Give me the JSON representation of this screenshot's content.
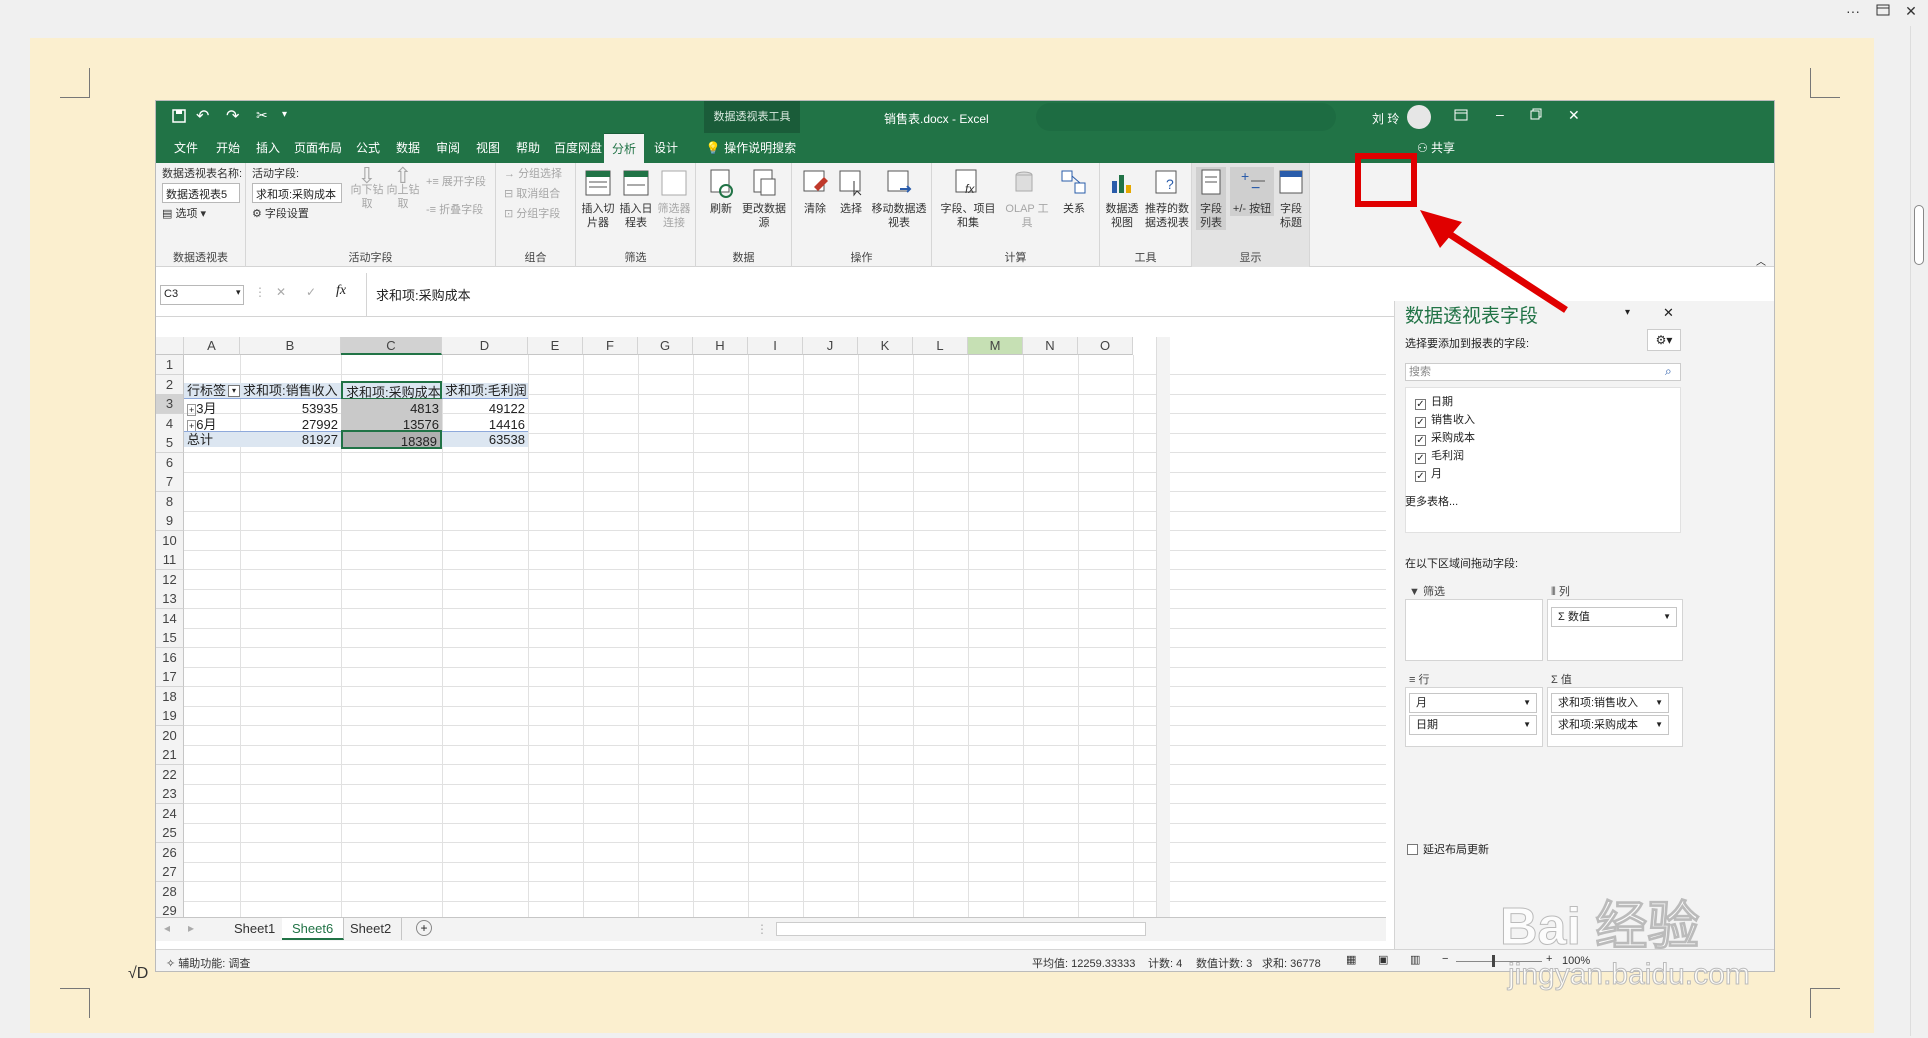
{
  "word": {
    "dots": "···"
  },
  "excel": {
    "file_title": "销售表.docx - Excel",
    "context_tools": "数据透视表工具",
    "user": "刘 玲",
    "share": "共享",
    "tell_me": "操作说明搜索",
    "tabs": [
      "文件",
      "开始",
      "插入",
      "页面布局",
      "公式",
      "数据",
      "审阅",
      "视图",
      "帮助",
      "百度网盘",
      "分析",
      "设计"
    ],
    "active_tab": "分析"
  },
  "ribbon": {
    "pivot": {
      "name_label": "数据透视表名称:",
      "name_value": "数据透视表5",
      "options": "选项",
      "group": "数据透视表"
    },
    "active_field": {
      "label": "活动字段:",
      "value": "求和项:采购成本",
      "settings": "字段设置",
      "drill_down": "向下钻取",
      "drill_up": "向上钻取",
      "expand": "展开字段",
      "collapse": "折叠字段",
      "group": "活动字段"
    },
    "group_grp": {
      "group_selection": "分组选择",
      "ungroup": "取消组合",
      "group_field": "分组字段",
      "group": "组合"
    },
    "filter": {
      "insert_slicer": "插入切片器",
      "insert_timeline": "插入日程表",
      "filter_conn": "筛选器连接",
      "group": "筛选"
    },
    "data": {
      "refresh": "刷新",
      "change_source": "更改数据源",
      "group": "数据"
    },
    "actions": {
      "clear": "清除",
      "select": "选择",
      "move": "移动数据透视表",
      "group": "操作"
    },
    "calc": {
      "fields_items": "字段、项目和集",
      "olap": "OLAP 工具",
      "relations": "关系",
      "group": "计算"
    },
    "tools": {
      "pivotchart": "数据透视图",
      "recommended": "推荐的数据透视表",
      "group": "工具"
    },
    "show": {
      "field_list": "字段列表",
      "buttons": "+/- 按钮",
      "headers": "字段标题",
      "group": "显示"
    }
  },
  "formula": {
    "namebox": "C3",
    "fx": "fx",
    "content": "求和项:采购成本"
  },
  "grid": {
    "columns": [
      "A",
      "B",
      "C",
      "D",
      "E",
      "F",
      "G",
      "H",
      "I",
      "J",
      "K",
      "L",
      "M",
      "N",
      "O"
    ],
    "rows": [
      "1",
      "2",
      "3",
      "4",
      "5",
      "6",
      "7",
      "8",
      "9",
      "10",
      "11",
      "12",
      "13",
      "14",
      "15",
      "16",
      "17",
      "18",
      "19",
      "20",
      "21",
      "22",
      "23",
      "24",
      "25",
      "26",
      "27",
      "28",
      "29"
    ],
    "header": [
      "行标签",
      "求和项:销售收入",
      "求和项:采购成本",
      "求和项:毛利润"
    ],
    "data": [
      {
        "label": "3月",
        "sales": "53935",
        "cost": "4813",
        "profit": "49122"
      },
      {
        "label": "6月",
        "sales": "27992",
        "cost": "13576",
        "profit": "14416"
      },
      {
        "label": "总计",
        "sales": "81927",
        "cost": "18389",
        "profit": "63538"
      }
    ]
  },
  "sheets": [
    "Sheet1",
    "Sheet6",
    "Sheet2"
  ],
  "active_sheet": "Sheet6",
  "status": {
    "accessibility": "辅助功能: 调查",
    "average": "平均值: 12259.33333",
    "count": "计数: 4",
    "numcount": "数值计数: 3",
    "sum": "求和: 36778",
    "zoom": "100%"
  },
  "pane": {
    "title": "数据透视表字段",
    "choose": "选择要添加到报表的字段:",
    "search_placeholder": "搜索",
    "fields": [
      "日期",
      "销售收入",
      "采购成本",
      "毛利润",
      "月"
    ],
    "more_tables": "更多表格...",
    "drag_label": "在以下区域间拖动字段:",
    "filters": "筛选",
    "columns": "列",
    "columns_item": "Σ 数值",
    "rows": "行",
    "rows_items": [
      "月",
      "日期"
    ],
    "values": "值",
    "values_items": [
      "求和项:销售收入",
      "求和项:采购成本"
    ],
    "defer": "延迟布局更新"
  },
  "watermark": {
    "brand": "Bai 经验",
    "url": "jingyan.baidu.com"
  },
  "colors": {
    "excel_green": "#217346",
    "highlight": "#e00000"
  }
}
